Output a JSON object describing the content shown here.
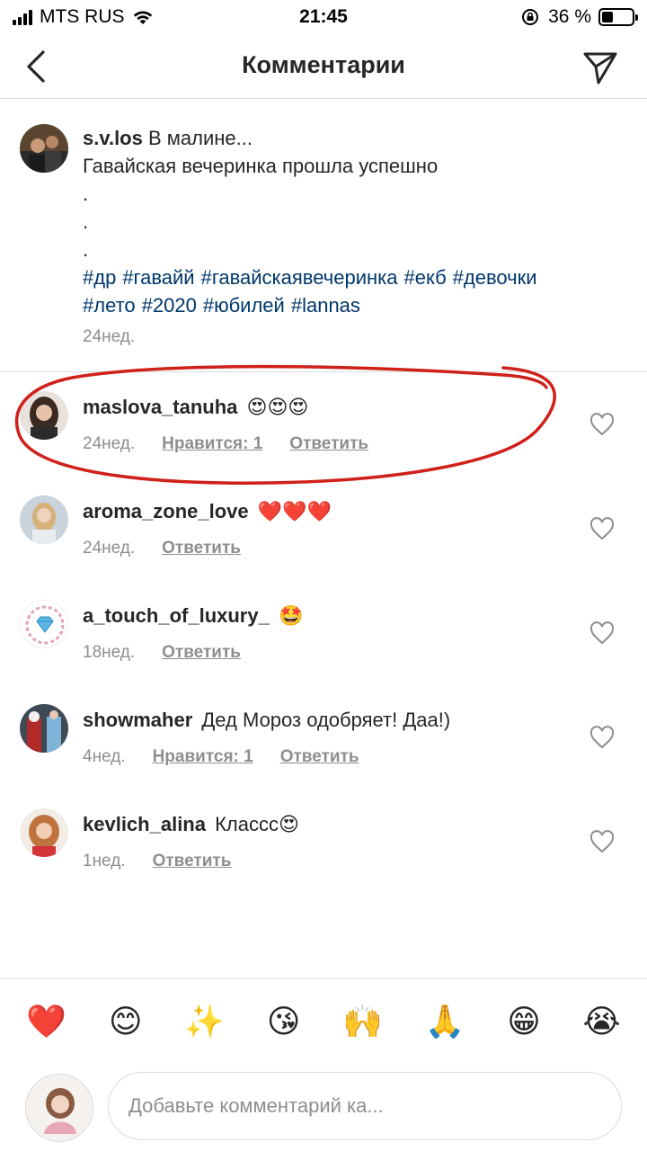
{
  "status_bar": {
    "carrier": "MTS RUS",
    "time": "21:45",
    "battery_percent": "36 %",
    "battery_level": 0.36
  },
  "header": {
    "title": "Комментарии",
    "back_icon": "chevron-left-icon",
    "share_icon": "paper-plane-icon"
  },
  "caption": {
    "username": "s.v.los",
    "line1": "В малине...",
    "line2": "Гавайская вечеринка прошла успешно",
    "dots": [
      ".",
      ".",
      "."
    ],
    "hashtags": [
      "#др",
      "#гавайй",
      "#гавайскаявечеринка",
      "#екб",
      "#девочки",
      "#лето",
      "#2020",
      "#юбилей",
      "#lannas"
    ],
    "time": "24нед."
  },
  "comments": [
    {
      "username": "maslova_tanuha",
      "text": "😍😍😍",
      "time": "24нед.",
      "likes": "Нравится: 1",
      "reply": "Ответить"
    },
    {
      "username": "aroma_zone_love",
      "text": "❤️❤️❤️",
      "time": "24нед.",
      "likes": "",
      "reply": "Ответить"
    },
    {
      "username": "a_touch_of_luxury_",
      "text": "🤩",
      "time": "18нед.",
      "likes": "",
      "reply": "Ответить"
    },
    {
      "username": "showmaher",
      "text": "Дед Мороз одобряет! Даа!)",
      "time": "4нед.",
      "likes": "Нравится: 1",
      "reply": "Ответить"
    },
    {
      "username": "kevlich_alina",
      "text": "Классс😍",
      "time": "1нед.",
      "likes": "",
      "reply": "Ответить"
    }
  ],
  "emoji_bar": [
    "❤️",
    "😊",
    "✨",
    "😘",
    "🙌",
    "🙏",
    "😁",
    "😭"
  ],
  "input": {
    "placeholder": "Добавьте комментарий ка..."
  },
  "colors": {
    "hashtag": "#00376b",
    "secondary_text": "#8e8e8e",
    "divider": "#dbdbdb",
    "annotation": "#d0201a"
  }
}
